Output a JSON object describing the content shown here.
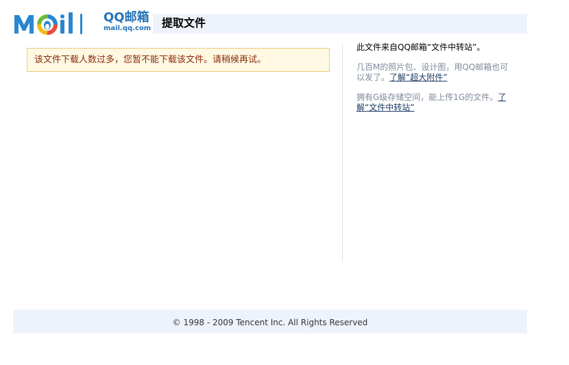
{
  "logo": {
    "name_cn": "QQ邮箱",
    "url": "mail.qq.com",
    "mark_text": "Mail",
    "colors": {
      "blue": "#2a86cf",
      "red": "#e94c3c",
      "green": "#6dbb3f",
      "yellow": "#f3bc1c"
    }
  },
  "header": {
    "title": "提取文件"
  },
  "notice": {
    "message": "该文件下载人数过多，您暂不能下载该文件。请稍候再试。"
  },
  "sidebar": {
    "intro": "此文件来自QQ邮箱“文件中转站”。",
    "p2_text": "几百M的照片包、设计图，用QQ邮箱也可以发了。",
    "p2_link": "了解“超大附件”",
    "p3_text": "拥有G级存储空间，能上传1G的文件。",
    "p3_link": "了解“文件中转站”"
  },
  "footer": {
    "copyright": "© 1998 - 2009 Tencent Inc. All Rights Reserved"
  }
}
